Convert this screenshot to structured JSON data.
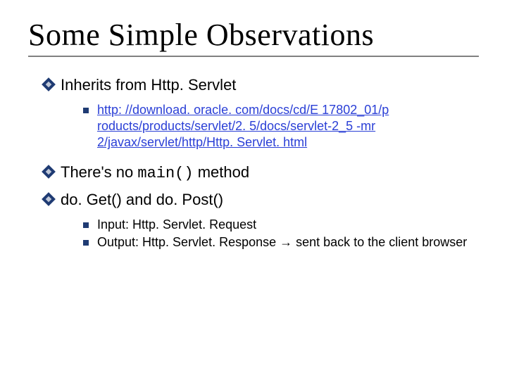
{
  "title": "Some Simple Observations",
  "bullets": {
    "b1": {
      "text": "Inherits from Http. Servlet"
    },
    "b1_sub1": {
      "text": "http: //download. oracle. com/docs/cd/E 17802_01/p roducts/products/servlet/2. 5/docs/servlet-2_5 -mr 2/javax/servlet/http/Http. Servlet. html"
    },
    "b2": {
      "pre": "There's no ",
      "code": "main()",
      "post": " method"
    },
    "b3": {
      "text": "do. Get() and do. Post()"
    },
    "b3_sub1": {
      "text": "Input: Http. Servlet. Request"
    },
    "b3_sub2": {
      "pre": "Output: Http. Servlet. Response ",
      "arrow": "→",
      "post": " sent back to the client browser"
    }
  }
}
